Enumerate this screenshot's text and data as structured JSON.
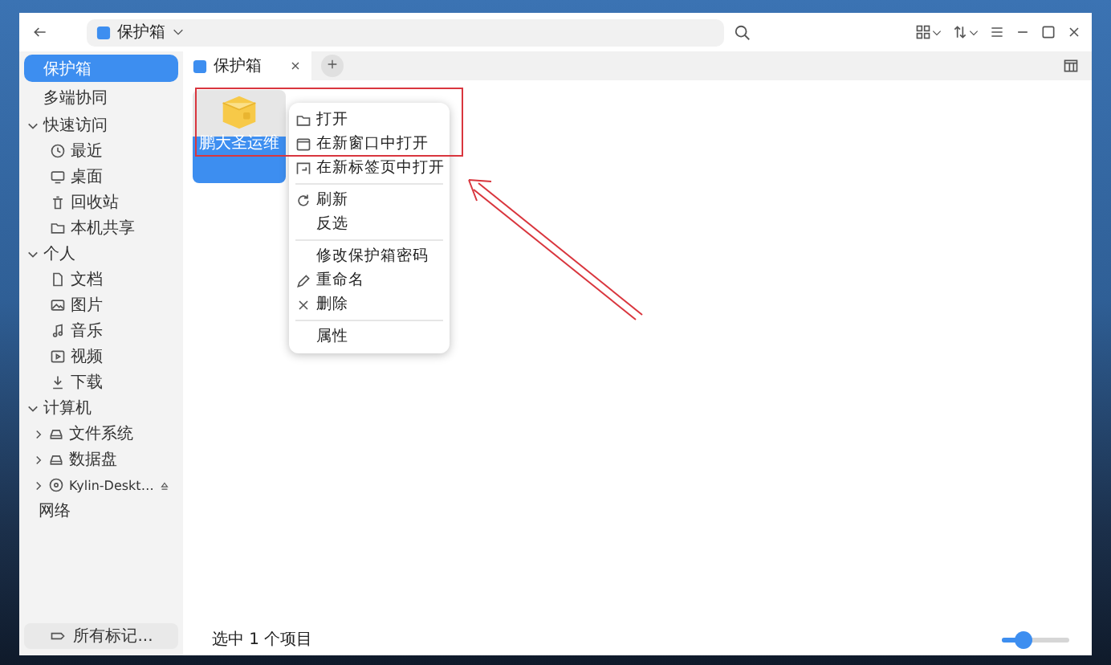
{
  "location": {
    "label": "保护箱"
  },
  "sidebar": {
    "places": [
      {
        "label": "保护箱",
        "selected": true
      },
      {
        "label": "多端协同",
        "selected": false
      }
    ],
    "groups": [
      {
        "label": "快速访问",
        "expanded": true,
        "children": [
          {
            "label": "最近"
          },
          {
            "label": "桌面"
          },
          {
            "label": "回收站"
          },
          {
            "label": "本机共享"
          }
        ]
      },
      {
        "label": "个人",
        "expanded": true,
        "children": [
          {
            "label": "文档"
          },
          {
            "label": "图片"
          },
          {
            "label": "音乐"
          },
          {
            "label": "视频"
          },
          {
            "label": "下载"
          }
        ]
      },
      {
        "label": "计算机",
        "expanded": true,
        "children": [
          {
            "label": "文件系统",
            "expanded": false
          },
          {
            "label": "数据盘",
            "expanded": false
          },
          {
            "label": "Kylin-Deskt…",
            "expanded": false,
            "eject": true
          }
        ]
      },
      {
        "label": "网络"
      }
    ],
    "tags": {
      "label": "所有标记..."
    }
  },
  "tabs": [
    {
      "label": "保护箱",
      "selected": true
    }
  ],
  "files": [
    {
      "name": "鹏大圣运维",
      "selected": true
    }
  ],
  "context_menu": {
    "sections": [
      [
        "打开",
        "在新窗口中打开",
        "在新标签页中打开"
      ],
      [
        "刷新",
        "反选"
      ],
      [
        "修改保护箱密码",
        "重命名",
        "删除"
      ],
      [
        "属性"
      ]
    ]
  },
  "status_bar": {
    "text": "选中 1 个项目",
    "zoom": {
      "level": 0.3
    }
  }
}
